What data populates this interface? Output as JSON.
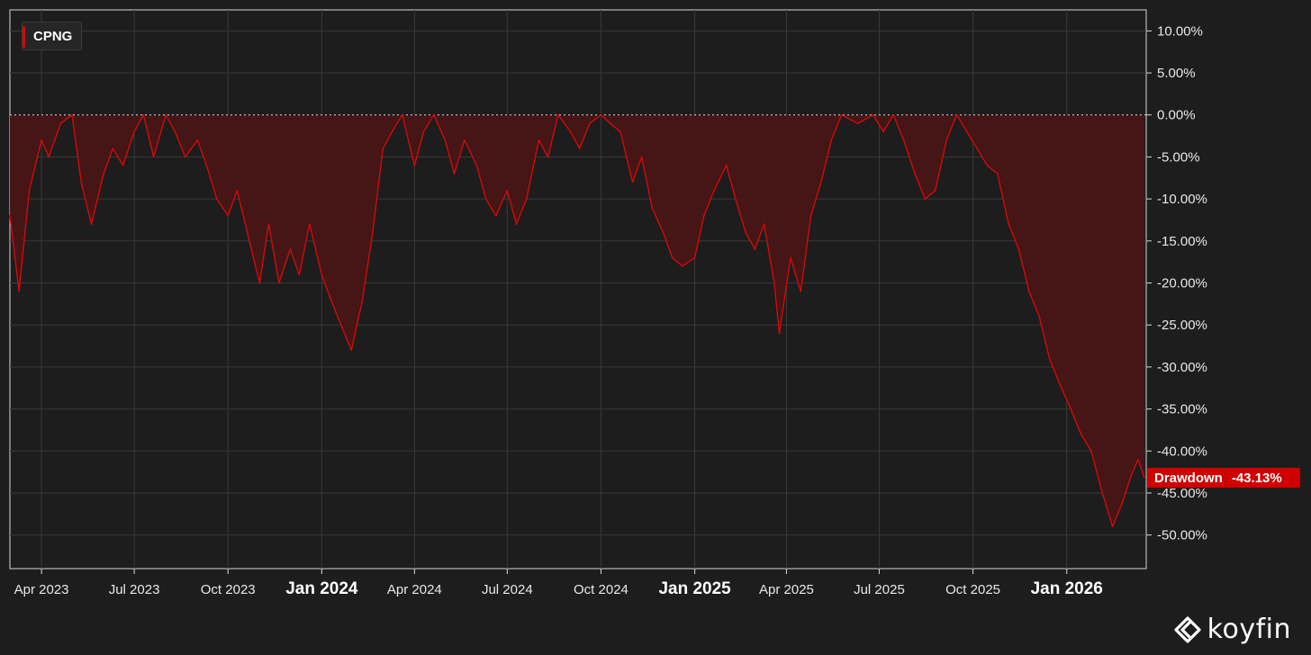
{
  "legend": {
    "ticker": "CPNG"
  },
  "badge": {
    "label": "Drawdown",
    "value": "-43.13%"
  },
  "brand": {
    "name": "koyfin"
  },
  "colors": {
    "background": "#1d1d1d",
    "series": "#d10a0a",
    "fill": "#4a1516",
    "grid": "#3a3a3a",
    "badge": "#d00000"
  },
  "chart_data": {
    "type": "area",
    "series": [
      {
        "name": "CPNG"
      }
    ],
    "ylim": [
      -54,
      12.5
    ],
    "y_ticks": [
      10,
      5,
      0,
      -5,
      -10,
      -15,
      -20,
      -25,
      -30,
      -35,
      -40,
      -45,
      -50
    ],
    "y_tick_labels": [
      "10.00%",
      "5.00%",
      "0.00%",
      "-5.00%",
      "-10.00%",
      "-15.00%",
      "-20.00%",
      "-25.00%",
      "-30.00%",
      "-35.00%",
      "-40.00%",
      "-45.00%",
      "-50.00%"
    ],
    "x_range": [
      "2023-03-01",
      "2026-03-20"
    ],
    "x_ticks": [
      {
        "date": "2023-04-01",
        "label": "Apr 2023",
        "major": false
      },
      {
        "date": "2023-07-01",
        "label": "Jul 2023",
        "major": false
      },
      {
        "date": "2023-10-01",
        "label": "Oct 2023",
        "major": false
      },
      {
        "date": "2024-01-01",
        "label": "Jan 2024",
        "major": true
      },
      {
        "date": "2024-04-01",
        "label": "Apr 2024",
        "major": false
      },
      {
        "date": "2024-07-01",
        "label": "Jul 2024",
        "major": false
      },
      {
        "date": "2024-10-01",
        "label": "Oct 2024",
        "major": false
      },
      {
        "date": "2025-01-01",
        "label": "Jan 2025",
        "major": true
      },
      {
        "date": "2025-04-01",
        "label": "Apr 2025",
        "major": false
      },
      {
        "date": "2025-07-01",
        "label": "Jul 2025",
        "major": false
      },
      {
        "date": "2025-10-01",
        "label": "Oct 2025",
        "major": false
      },
      {
        "date": "2026-01-01",
        "label": "Jan 2026",
        "major": true
      }
    ],
    "points": [
      [
        "2023-03-01",
        -12
      ],
      [
        "2023-03-10",
        -21
      ],
      [
        "2023-03-20",
        -9
      ],
      [
        "2023-04-01",
        -3
      ],
      [
        "2023-04-08",
        -5
      ],
      [
        "2023-04-20",
        -1
      ],
      [
        "2023-05-01",
        0
      ],
      [
        "2023-05-10",
        -8
      ],
      [
        "2023-05-20",
        -13
      ],
      [
        "2023-06-01",
        -7
      ],
      [
        "2023-06-10",
        -4
      ],
      [
        "2023-06-20",
        -6
      ],
      [
        "2023-07-01",
        -2
      ],
      [
        "2023-07-10",
        0
      ],
      [
        "2023-07-20",
        -5
      ],
      [
        "2023-08-01",
        0
      ],
      [
        "2023-08-10",
        -2
      ],
      [
        "2023-08-20",
        -5
      ],
      [
        "2023-09-01",
        -3
      ],
      [
        "2023-09-10",
        -6
      ],
      [
        "2023-09-20",
        -10
      ],
      [
        "2023-10-01",
        -12
      ],
      [
        "2023-10-10",
        -9
      ],
      [
        "2023-10-20",
        -14
      ],
      [
        "2023-11-01",
        -20
      ],
      [
        "2023-11-10",
        -13
      ],
      [
        "2023-11-20",
        -20
      ],
      [
        "2023-12-01",
        -16
      ],
      [
        "2023-12-10",
        -19
      ],
      [
        "2023-12-20",
        -13
      ],
      [
        "2024-01-01",
        -19
      ],
      [
        "2024-01-10",
        -22
      ],
      [
        "2024-01-20",
        -25
      ],
      [
        "2024-01-30",
        -28
      ],
      [
        "2024-02-10",
        -22
      ],
      [
        "2024-02-20",
        -14
      ],
      [
        "2024-03-01",
        -4
      ],
      [
        "2024-03-10",
        -2
      ],
      [
        "2024-03-20",
        0
      ],
      [
        "2024-04-01",
        -6
      ],
      [
        "2024-04-10",
        -2
      ],
      [
        "2024-04-20",
        0
      ],
      [
        "2024-05-01",
        -3
      ],
      [
        "2024-05-10",
        -7
      ],
      [
        "2024-05-20",
        -3
      ],
      [
        "2024-06-01",
        -6
      ],
      [
        "2024-06-10",
        -10
      ],
      [
        "2024-06-20",
        -12
      ],
      [
        "2024-07-01",
        -9
      ],
      [
        "2024-07-10",
        -13
      ],
      [
        "2024-07-20",
        -10
      ],
      [
        "2024-08-01",
        -3
      ],
      [
        "2024-08-10",
        -5
      ],
      [
        "2024-08-20",
        0
      ],
      [
        "2024-09-01",
        -2
      ],
      [
        "2024-09-10",
        -4
      ],
      [
        "2024-09-20",
        -1
      ],
      [
        "2024-10-01",
        0
      ],
      [
        "2024-10-10",
        -1
      ],
      [
        "2024-10-20",
        -2
      ],
      [
        "2024-11-01",
        -8
      ],
      [
        "2024-11-10",
        -5
      ],
      [
        "2024-11-20",
        -11
      ],
      [
        "2024-12-01",
        -14
      ],
      [
        "2024-12-10",
        -17
      ],
      [
        "2024-12-20",
        -18
      ],
      [
        "2025-01-01",
        -17
      ],
      [
        "2025-01-10",
        -12
      ],
      [
        "2025-01-20",
        -9
      ],
      [
        "2025-02-01",
        -6
      ],
      [
        "2025-02-10",
        -10
      ],
      [
        "2025-02-20",
        -14
      ],
      [
        "2025-03-01",
        -16
      ],
      [
        "2025-03-10",
        -13
      ],
      [
        "2025-03-20",
        -20
      ],
      [
        "2025-03-25",
        -26
      ],
      [
        "2025-04-05",
        -17
      ],
      [
        "2025-04-15",
        -21
      ],
      [
        "2025-04-25",
        -12
      ],
      [
        "2025-05-05",
        -8
      ],
      [
        "2025-05-15",
        -3
      ],
      [
        "2025-05-25",
        0
      ],
      [
        "2025-06-10",
        -1
      ],
      [
        "2025-06-25",
        0
      ],
      [
        "2025-07-05",
        -2
      ],
      [
        "2025-07-15",
        0
      ],
      [
        "2025-07-25",
        -3
      ],
      [
        "2025-08-05",
        -7
      ],
      [
        "2025-08-15",
        -10
      ],
      [
        "2025-08-25",
        -9
      ],
      [
        "2025-09-05",
        -3
      ],
      [
        "2025-09-15",
        0
      ],
      [
        "2025-09-25",
        -2
      ],
      [
        "2025-10-05",
        -4
      ],
      [
        "2025-10-15",
        -6
      ],
      [
        "2025-10-25",
        -7
      ],
      [
        "2025-11-05",
        -13
      ],
      [
        "2025-11-15",
        -16
      ],
      [
        "2025-11-25",
        -21
      ],
      [
        "2025-12-05",
        -24
      ],
      [
        "2025-12-15",
        -29
      ],
      [
        "2025-12-25",
        -32
      ],
      [
        "2026-01-05",
        -35
      ],
      [
        "2026-01-15",
        -38
      ],
      [
        "2026-01-25",
        -40
      ],
      [
        "2026-02-05",
        -45
      ],
      [
        "2026-02-15",
        -49
      ],
      [
        "2026-02-25",
        -46
      ],
      [
        "2026-03-05",
        -43
      ],
      [
        "2026-03-12",
        -41
      ],
      [
        "2026-03-18",
        -43.13
      ]
    ]
  }
}
